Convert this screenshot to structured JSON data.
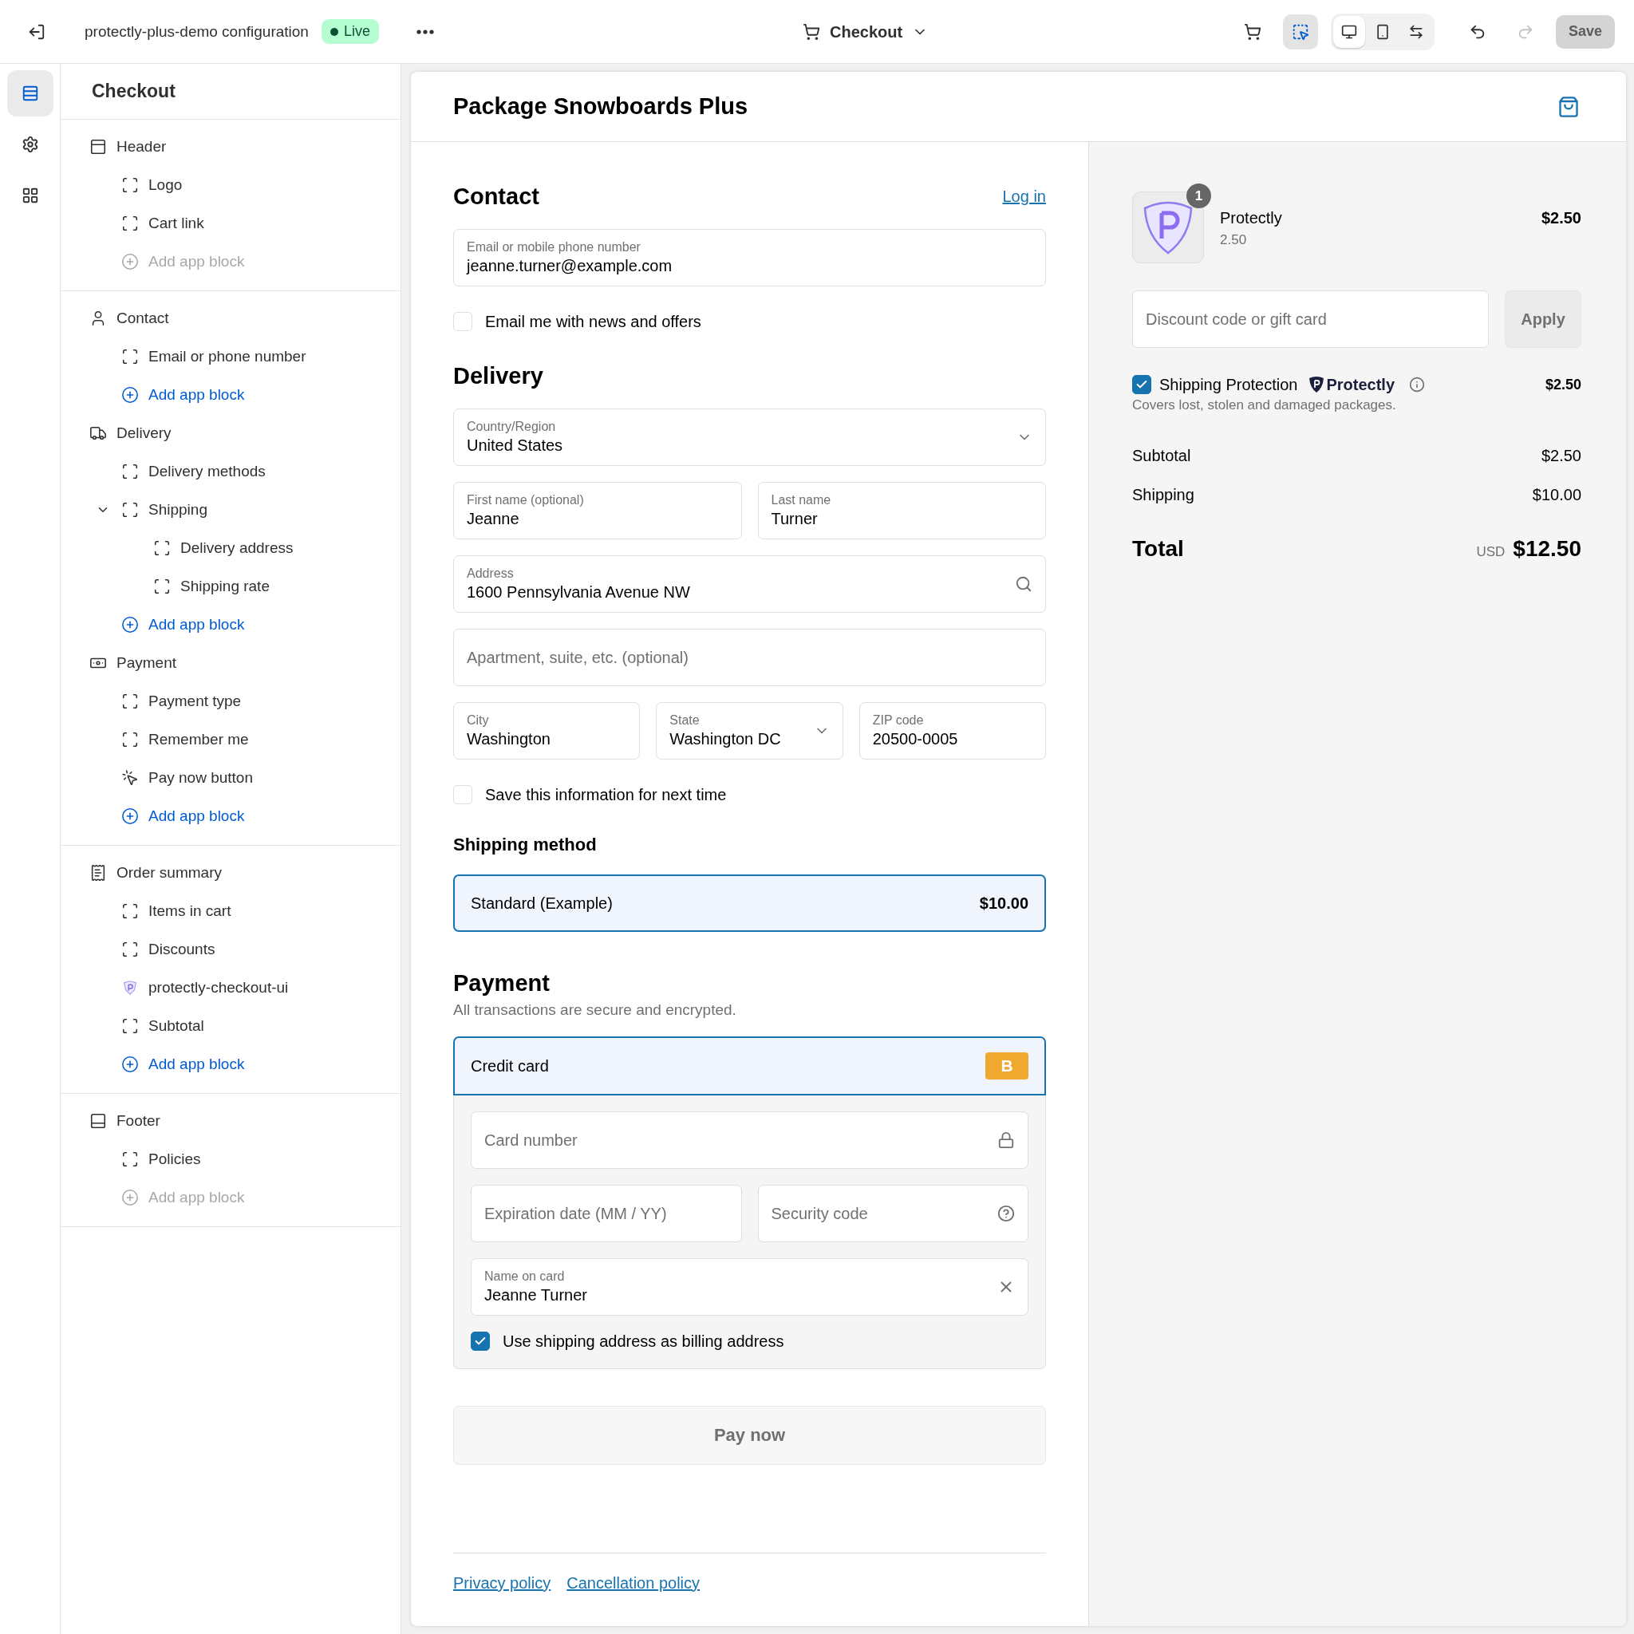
{
  "topbar": {
    "title": "protectly-plus-demo configuration",
    "status": "Live",
    "page": "Checkout",
    "inspect_active": true,
    "views": [
      {
        "kind": "desktop",
        "selected": true
      },
      {
        "kind": "mobile",
        "selected": false
      },
      {
        "kind": "fullwidth",
        "selected": false
      }
    ],
    "save": {
      "label": "Save",
      "disabled": true
    }
  },
  "rail": [
    {
      "kind": "sections",
      "selected": true
    },
    {
      "kind": "settings",
      "selected": false
    },
    {
      "kind": "apps",
      "selected": false
    }
  ],
  "sidebar": {
    "title": "Checkout",
    "sections": [
      {
        "groups": [
          {
            "label": "Header",
            "kind": "header",
            "children": [
              {
                "label": "Logo",
                "kind": "block"
              },
              {
                "label": "Cart link",
                "kind": "block"
              },
              {
                "label": "Add app block",
                "kind": "add",
                "disabled": true
              }
            ]
          }
        ]
      },
      {
        "groups": [
          {
            "label": "Contact",
            "kind": "contact",
            "children": [
              {
                "label": "Email or phone number",
                "kind": "block"
              },
              {
                "label": "Add app block",
                "kind": "add",
                "disabled": false
              }
            ]
          },
          {
            "label": "Delivery",
            "kind": "delivery",
            "children": [
              {
                "label": "Delivery methods",
                "kind": "block"
              },
              {
                "label": "Shipping",
                "kind": "block",
                "expanded": true,
                "children": [
                  {
                    "label": "Delivery address",
                    "kind": "block"
                  },
                  {
                    "label": "Shipping rate",
                    "kind": "block"
                  }
                ]
              },
              {
                "label": "Add app block",
                "kind": "add",
                "disabled": false
              }
            ]
          },
          {
            "label": "Payment",
            "kind": "payment",
            "children": [
              {
                "label": "Payment type",
                "kind": "block"
              },
              {
                "label": "Remember me",
                "kind": "block"
              },
              {
                "label": "Pay now button",
                "kind": "button"
              },
              {
                "label": "Add app block",
                "kind": "add",
                "disabled": false
              }
            ]
          }
        ]
      },
      {
        "groups": [
          {
            "label": "Order summary",
            "kind": "summary",
            "children": [
              {
                "label": "Items in cart",
                "kind": "block"
              },
              {
                "label": "Discounts",
                "kind": "block"
              },
              {
                "label": "protectly-checkout-ui",
                "kind": "app"
              },
              {
                "label": "Subtotal",
                "kind": "block"
              },
              {
                "label": "Add app block",
                "kind": "add",
                "disabled": false
              }
            ]
          }
        ]
      },
      {
        "groups": [
          {
            "label": "Footer",
            "kind": "footer",
            "children": [
              {
                "label": "Policies",
                "kind": "block"
              },
              {
                "label": "Add app block",
                "kind": "add",
                "disabled": true
              }
            ]
          }
        ]
      }
    ]
  },
  "checkout": {
    "store_name": "Package Snowboards Plus",
    "contact": {
      "title": "Contact",
      "login": "Log in",
      "email": {
        "label": "Email or mobile phone number",
        "value": "jeanne.turner@example.com"
      },
      "news": {
        "label": "Email me with news and offers",
        "checked": false
      }
    },
    "delivery": {
      "title": "Delivery",
      "country": {
        "label": "Country/Region",
        "value": "United States"
      },
      "first_name": {
        "label": "First name (optional)",
        "value": "Jeanne"
      },
      "last_name": {
        "label": "Last name",
        "value": "Turner"
      },
      "address": {
        "label": "Address",
        "value": "1600 Pennsylvania Avenue NW"
      },
      "apartment": {
        "placeholder": "Apartment, suite, etc. (optional)"
      },
      "city": {
        "label": "City",
        "value": "Washington"
      },
      "state": {
        "label": "State",
        "value": "Washington DC"
      },
      "zip": {
        "label": "ZIP code",
        "value": "20500-0005"
      },
      "save_info": {
        "label": "Save this information for next time",
        "checked": false
      }
    },
    "shipping_method": {
      "title": "Shipping method",
      "options": [
        {
          "label": "Standard (Example)",
          "price": "$10.00",
          "selected": true
        }
      ]
    },
    "payment": {
      "title": "Payment",
      "subtitle": "All transactions are secure and encrypted.",
      "methods": [
        {
          "label": "Credit card",
          "badge": "B",
          "selected": true
        }
      ],
      "card_number": {
        "placeholder": "Card number"
      },
      "expiry": {
        "placeholder": "Expiration date (MM / YY)"
      },
      "security": {
        "placeholder": "Security code"
      },
      "name_on_card": {
        "label": "Name on card",
        "value": "Jeanne Turner"
      },
      "billing": {
        "label": "Use shipping address as billing address",
        "checked": true
      }
    },
    "pay_button": "Pay now",
    "policies": [
      "Privacy policy",
      "Cancellation policy"
    ]
  },
  "summary": {
    "item": {
      "name": "Protectly",
      "quantity": "1",
      "detail": "2.50",
      "price": "$2.50"
    },
    "discount": {
      "placeholder": "Discount code or gift card"
    },
    "apply": "Apply",
    "protection": {
      "checked": true,
      "label": "Shipping Protection",
      "brand": "Protectly",
      "price": "$2.50",
      "note": "Covers lost, stolen and damaged packages."
    },
    "lines": [
      {
        "label": "Subtotal",
        "value": "$2.50"
      },
      {
        "label": "Shipping",
        "value": "$10.00"
      }
    ],
    "total": {
      "label": "Total",
      "currency": "USD",
      "value": "$12.50"
    }
  }
}
